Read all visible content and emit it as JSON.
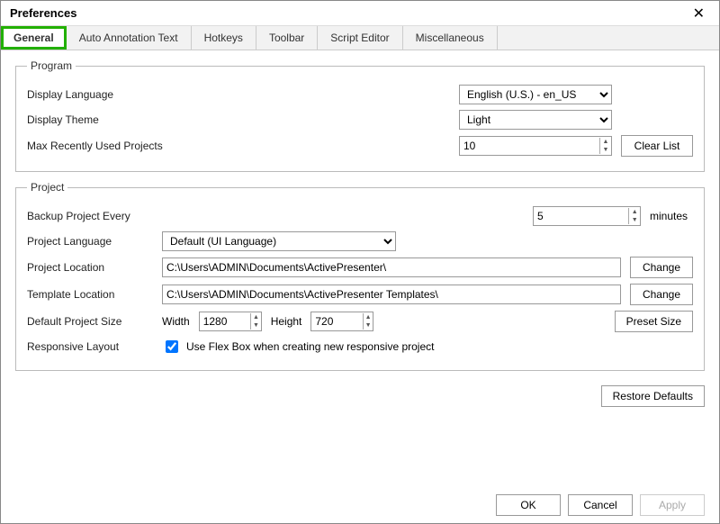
{
  "window": {
    "title": "Preferences"
  },
  "tabs": {
    "general": "General",
    "auto_annotation": "Auto Annotation Text",
    "hotkeys": "Hotkeys",
    "toolbar": "Toolbar",
    "script_editor": "Script Editor",
    "misc": "Miscellaneous"
  },
  "program": {
    "legend": "Program",
    "display_language_label": "Display Language",
    "display_language_value": "English (U.S.) - en_US",
    "display_theme_label": "Display Theme",
    "display_theme_value": "Light",
    "max_recent_label": "Max Recently Used Projects",
    "max_recent_value": "10",
    "clear_list": "Clear List"
  },
  "project": {
    "legend": "Project",
    "backup_label": "Backup Project Every",
    "backup_value": "5",
    "backup_unit": "minutes",
    "lang_label": "Project Language",
    "lang_value": "Default (UI Language)",
    "location_label": "Project Location",
    "location_value": "C:\\Users\\ADMIN\\Documents\\ActivePresenter\\",
    "template_label": "Template Location",
    "template_value": "C:\\Users\\ADMIN\\Documents\\ActivePresenter Templates\\",
    "change": "Change",
    "default_size_label": "Default Project Size",
    "width_label": "Width",
    "width_value": "1280",
    "height_label": "Height",
    "height_value": "720",
    "preset_size": "Preset Size",
    "responsive_label": "Responsive Layout",
    "responsive_checkbox": "Use Flex Box when creating new responsive project"
  },
  "actions": {
    "restore_defaults": "Restore Defaults",
    "ok": "OK",
    "cancel": "Cancel",
    "apply": "Apply"
  }
}
